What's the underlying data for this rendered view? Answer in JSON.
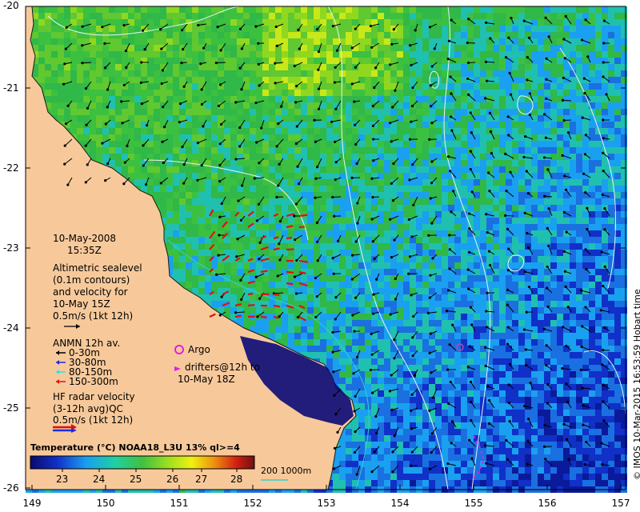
{
  "date": "10-May-2008",
  "time": "15:35Z",
  "altimetry_lines": [
    "Altimetric sealevel",
    "(0.1m contours)",
    "and velocity for",
    "10-May 15Z",
    "0.5m/s (1kt 12h)"
  ],
  "anmn": {
    "title": "ANMN 12h av.",
    "items": [
      {
        "label": "0-30m",
        "color": "#000000"
      },
      {
        "label": "30-80m",
        "color": "#1a2ce0"
      },
      {
        "label": "80-150m",
        "color": "#30e0e0"
      },
      {
        "label": "150-300m",
        "color": "#e01010"
      }
    ]
  },
  "argo_lines": [
    "Argo",
    "drifters@12h to",
    "10-May 18Z"
  ],
  "hf_lines": [
    "HF radar velocity",
    "(3-12h avg)QC",
    "0.5m/s (1kt 12h)"
  ],
  "colorbar": {
    "title": "Temperature (°C) NOAA18_L3U 13% ql>=4",
    "ticks": [
      "23",
      "24",
      "25",
      "26",
      "27",
      "28"
    ]
  },
  "isobath_label": "200  1000m",
  "credit": "© IMOS 10-Mar-2015 16:53:59 Hobart time",
  "axes": {
    "lat_ticks": [
      "-20",
      "-21",
      "-22",
      "-23",
      "-24",
      "-25",
      "-26"
    ],
    "lon_ticks": [
      "149",
      "150",
      "151",
      "152",
      "153",
      "154",
      "155",
      "156",
      "157"
    ]
  },
  "colors": {
    "land": "#f7c99a",
    "coast": "#1a1a1a",
    "hf_red": "#e01010",
    "hf_blue": "#1a2ce0",
    "argo": "#e020e0",
    "contour": "#e8f4f4",
    "isobath": "#30d0d0"
  }
}
